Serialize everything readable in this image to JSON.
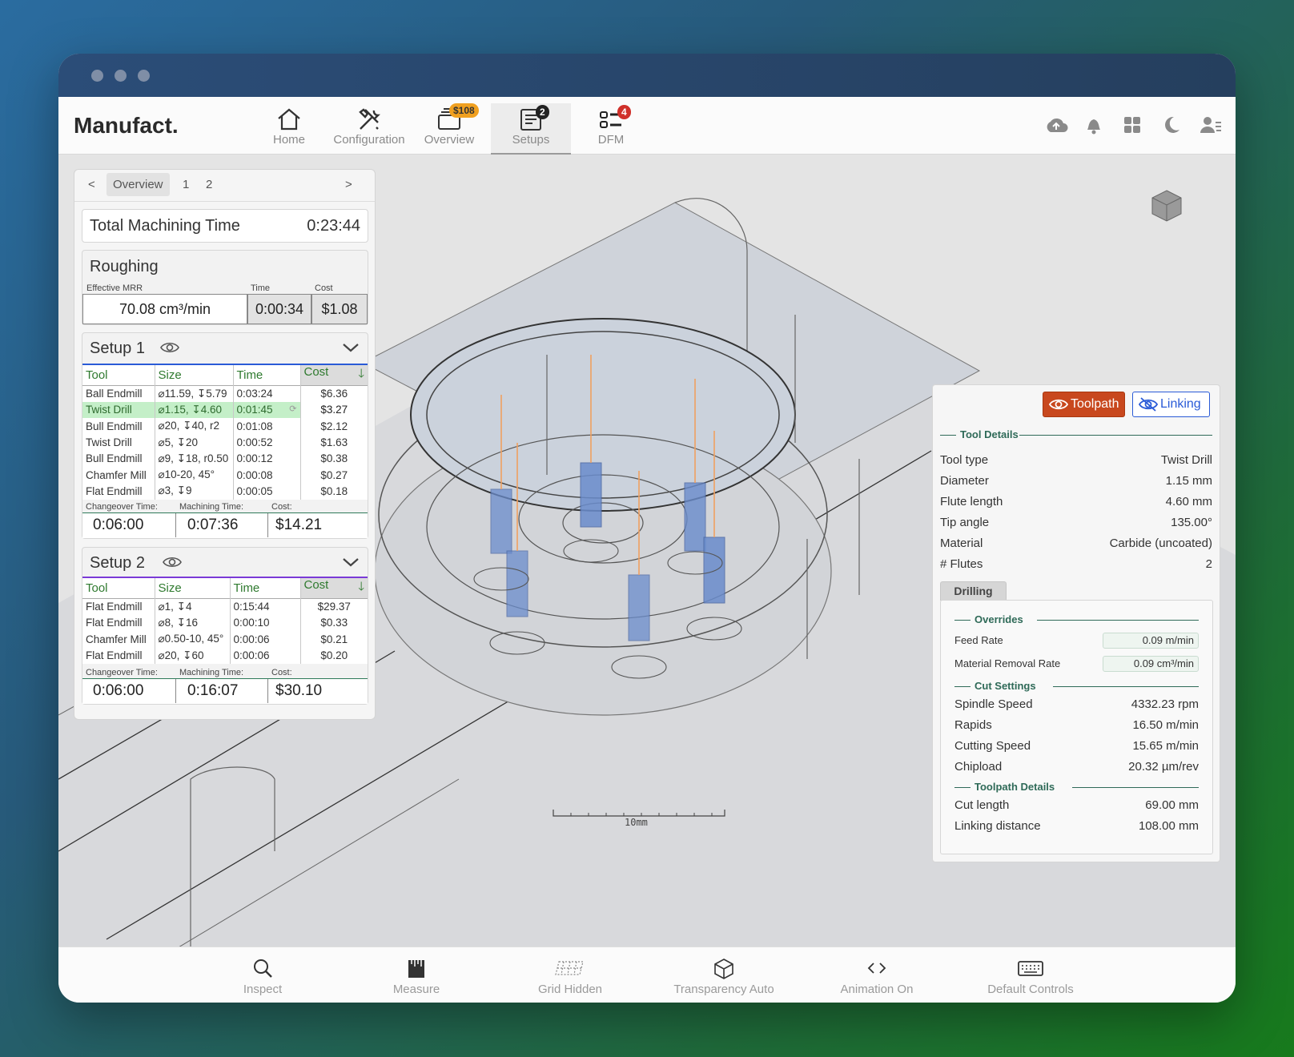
{
  "app": {
    "brand": "Manufact."
  },
  "nav": {
    "items": [
      {
        "label": "Home"
      },
      {
        "label": "Configuration"
      },
      {
        "label": "Overview",
        "badge": "$108"
      },
      {
        "label": "Setups",
        "badge": "2"
      },
      {
        "label": "DFM",
        "badge": "4"
      }
    ]
  },
  "left_panel": {
    "tabs": {
      "prev": "<",
      "active": "Overview",
      "t1": "1",
      "t2": "2",
      "next": ">"
    },
    "total": {
      "label": "Total Machining Time",
      "value": "0:23:44"
    },
    "roughing": {
      "title": "Roughing",
      "mrr_label": "Effective MRR",
      "time_label": "Time",
      "cost_label": "Cost",
      "mrr": "70.08 cm³/min",
      "time": "0:00:34",
      "cost": "$1.08"
    },
    "setup1": {
      "title": "Setup 1",
      "headers": [
        "Tool",
        "Size",
        "Time",
        "Cost"
      ],
      "rows": [
        [
          "Ball Endmill",
          "⌀11.59, ↧5.79",
          "0:03:24",
          "$6.36"
        ],
        [
          "Twist Drill",
          "⌀1.15, ↧4.60",
          "0:01:45",
          "$3.27"
        ],
        [
          "Bull Endmill",
          "⌀20, ↧40, r2",
          "0:01:08",
          "$2.12"
        ],
        [
          "Twist Drill",
          "⌀5, ↧20",
          "0:00:52",
          "$1.63"
        ],
        [
          "Bull Endmill",
          "⌀9, ↧18, r0.50",
          "0:00:12",
          "$0.38"
        ],
        [
          "Chamfer Mill",
          "⌀10-20, 45°",
          "0:00:08",
          "$0.27"
        ],
        [
          "Flat Endmill",
          "⌀3, ↧9",
          "0:00:05",
          "$0.18"
        ]
      ],
      "changeover_label": "Changeover Time:",
      "machining_label": "Machining Time:",
      "cost_label": "Cost:",
      "changeover": "0:06:00",
      "machining": "0:07:36",
      "cost": "$14.21"
    },
    "setup2": {
      "title": "Setup 2",
      "headers": [
        "Tool",
        "Size",
        "Time",
        "Cost"
      ],
      "rows": [
        [
          "Flat Endmill",
          "⌀1, ↧4",
          "0:15:44",
          "$29.37"
        ],
        [
          "Flat Endmill",
          "⌀8, ↧16",
          "0:00:10",
          "$0.33"
        ],
        [
          "Chamfer Mill",
          "⌀0.50-10, 45°",
          "0:00:06",
          "$0.21"
        ],
        [
          "Flat Endmill",
          "⌀20, ↧60",
          "0:00:06",
          "$0.20"
        ]
      ],
      "changeover_label": "Changeover Time:",
      "machining_label": "Machining Time:",
      "cost_label": "Cost:",
      "changeover": "0:06:00",
      "machining": "0:16:07",
      "cost": "$30.10"
    }
  },
  "viewport": {
    "scale_label": "10mm"
  },
  "right_panel": {
    "toolpath_btn": "Toolpath",
    "linking_btn": "Linking",
    "tool_details_title": "Tool Details",
    "tool_details": [
      {
        "k": "Tool type",
        "v": "Twist Drill"
      },
      {
        "k": "Diameter",
        "v": "1.15 mm"
      },
      {
        "k": "Flute length",
        "v": "4.60 mm"
      },
      {
        "k": "Tip angle",
        "v": "135.00°"
      },
      {
        "k": "Material",
        "v": "Carbide (uncoated)"
      },
      {
        "k": "# Flutes",
        "v": "2"
      }
    ],
    "op_tab": "Drilling",
    "overrides_title": "Overrides",
    "overrides": [
      {
        "k": "Feed Rate",
        "v": "0.09 m/min"
      },
      {
        "k": "Material Removal Rate",
        "v": "0.09 cm³/min"
      }
    ],
    "cut_settings_title": "Cut Settings",
    "cut_settings": [
      {
        "k": "Spindle Speed",
        "v": "4332.23 rpm"
      },
      {
        "k": "Rapids",
        "v": "16.50 m/min"
      },
      {
        "k": "Cutting Speed",
        "v": "15.65 m/min"
      },
      {
        "k": "Chipload",
        "v": "20.32 µm/rev"
      }
    ],
    "toolpath_details_title": "Toolpath Details",
    "toolpath_details": [
      {
        "k": "Cut length",
        "v": "69.00 mm"
      },
      {
        "k": "Linking distance",
        "v": "108.00 mm"
      }
    ]
  },
  "bottom_bar": {
    "items": [
      {
        "label": "Inspect"
      },
      {
        "label": "Measure"
      },
      {
        "label": "Grid Hidden"
      },
      {
        "label": "Transparency Auto"
      },
      {
        "label": "Animation On"
      },
      {
        "label": "Default Controls"
      }
    ]
  },
  "colors": {
    "accent_green": "#2f7a2f",
    "toolpath_red": "#c8481e",
    "linking_blue": "#2a5bd7",
    "badge_orange": "#f0a020",
    "badge_red": "#d0302a"
  }
}
